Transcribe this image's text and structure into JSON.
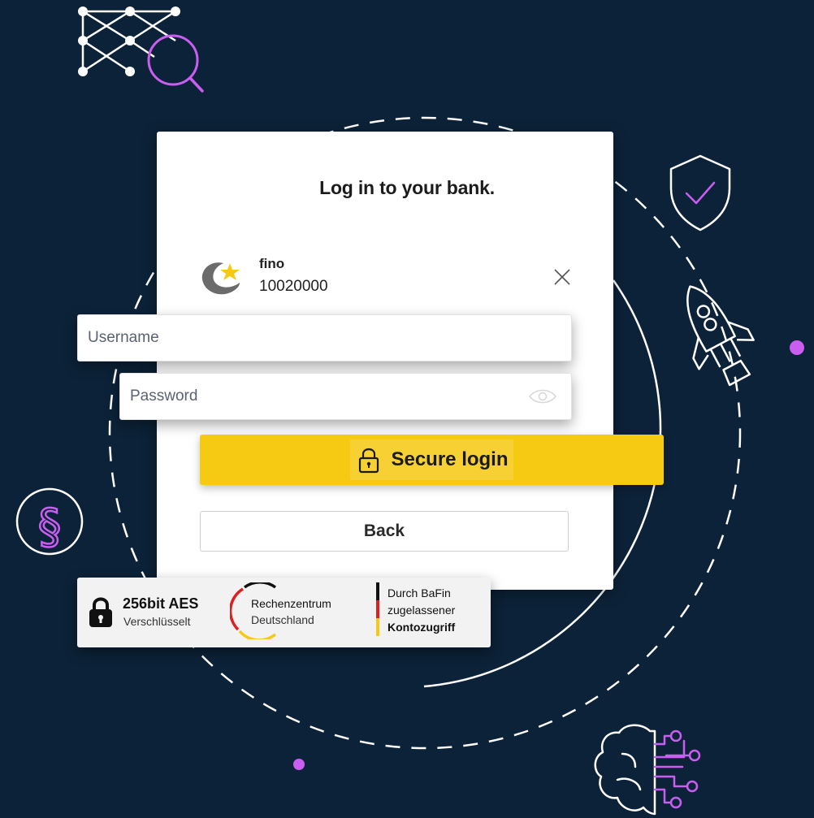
{
  "login": {
    "title": "Log in to your bank.",
    "bank": {
      "name": "fino",
      "code": "10020000",
      "logo_icon": "fino-crescent-logo"
    },
    "username_placeholder": "Username",
    "password_placeholder": "Password",
    "secure_login_label": "Secure login",
    "back_label": "Back"
  },
  "trust_bar": {
    "encryption_title": "256bit AES",
    "encryption_subtitle": "Verschlüsselt",
    "datacenter_line1": "Rechenzentrum",
    "datacenter_line2": "Deutschland",
    "bafin_line1": "Durch BaFin",
    "bafin_line2": "zugelassener",
    "bafin_line3": "Kontozugriff"
  },
  "colors": {
    "background": "#0c2238",
    "accent_yellow": "#f6c913",
    "accent_purple": "#c95ef0",
    "flag_black": "#111111",
    "flag_red": "#dd1f1f",
    "flag_gold": "#f6c913"
  },
  "decorative_icons": [
    "network-search-icon",
    "shield-check-icon",
    "rocket-icon",
    "paragraph-icon",
    "brain-circuit-icon"
  ]
}
